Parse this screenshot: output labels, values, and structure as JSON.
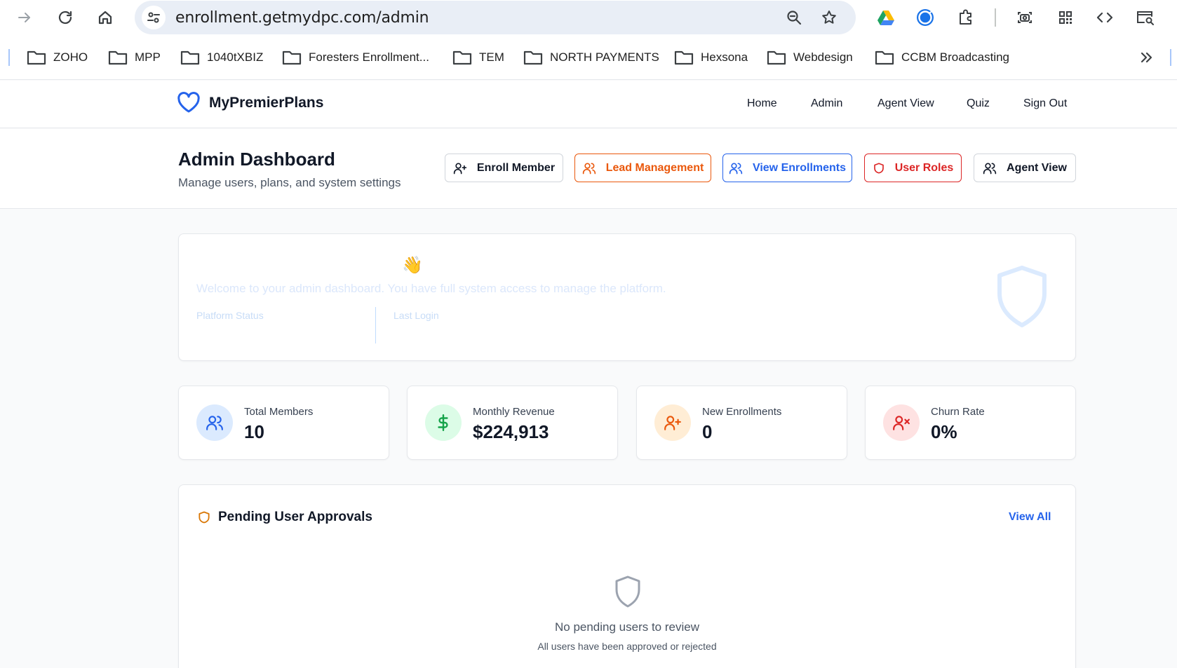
{
  "browser": {
    "url": "enrollment.getmydpc.com/admin",
    "bookmarks": [
      {
        "label": "ZOHO"
      },
      {
        "label": "MPP"
      },
      {
        "label": "1040tXBIZ"
      },
      {
        "label": "Foresters Enrollment..."
      },
      {
        "label": "TEM"
      },
      {
        "label": "NORTH PAYMENTS"
      },
      {
        "label": "Hexsona"
      },
      {
        "label": "Webdesign"
      },
      {
        "label": "CCBM Broadcasting"
      }
    ]
  },
  "app": {
    "brand": "MyPremierPlans",
    "brand_color": "#2563eb",
    "nav": [
      "Home",
      "Admin",
      "Agent View",
      "Quiz",
      "Sign Out"
    ]
  },
  "page": {
    "title": "Admin Dashboard",
    "subtitle": "Manage users, plans, and system settings",
    "actions": {
      "enroll": "Enroll Member",
      "leads": "Lead Management",
      "enrollments": "View Enrollments",
      "roles": "User Roles",
      "agent": "Agent View"
    }
  },
  "welcome": {
    "emoji": "👋",
    "message": "Welcome to your admin dashboard. You have full system access to manage the platform.",
    "status_label": "Platform Status",
    "login_label": "Last Login"
  },
  "metrics": [
    {
      "label": "Total Members",
      "value": "10",
      "icon": "users-icon",
      "color": "#2563eb",
      "bg": "#dbeafe"
    },
    {
      "label": "Monthly Revenue",
      "value": "$224,913",
      "icon": "dollar-icon",
      "color": "#16a34a",
      "bg": "#dcfce7"
    },
    {
      "label": "New Enrollments",
      "value": "0",
      "icon": "user-plus-icon",
      "color": "#ea580c",
      "bg": "#ffedd5"
    },
    {
      "label": "Churn Rate",
      "value": "0%",
      "icon": "user-x-icon",
      "color": "#dc2626",
      "bg": "#fee2e2"
    }
  ],
  "pending": {
    "title": "Pending User Approvals",
    "view_all": "View All",
    "empty_title": "No pending users to review",
    "empty_sub": "All users have been approved or rejected"
  }
}
